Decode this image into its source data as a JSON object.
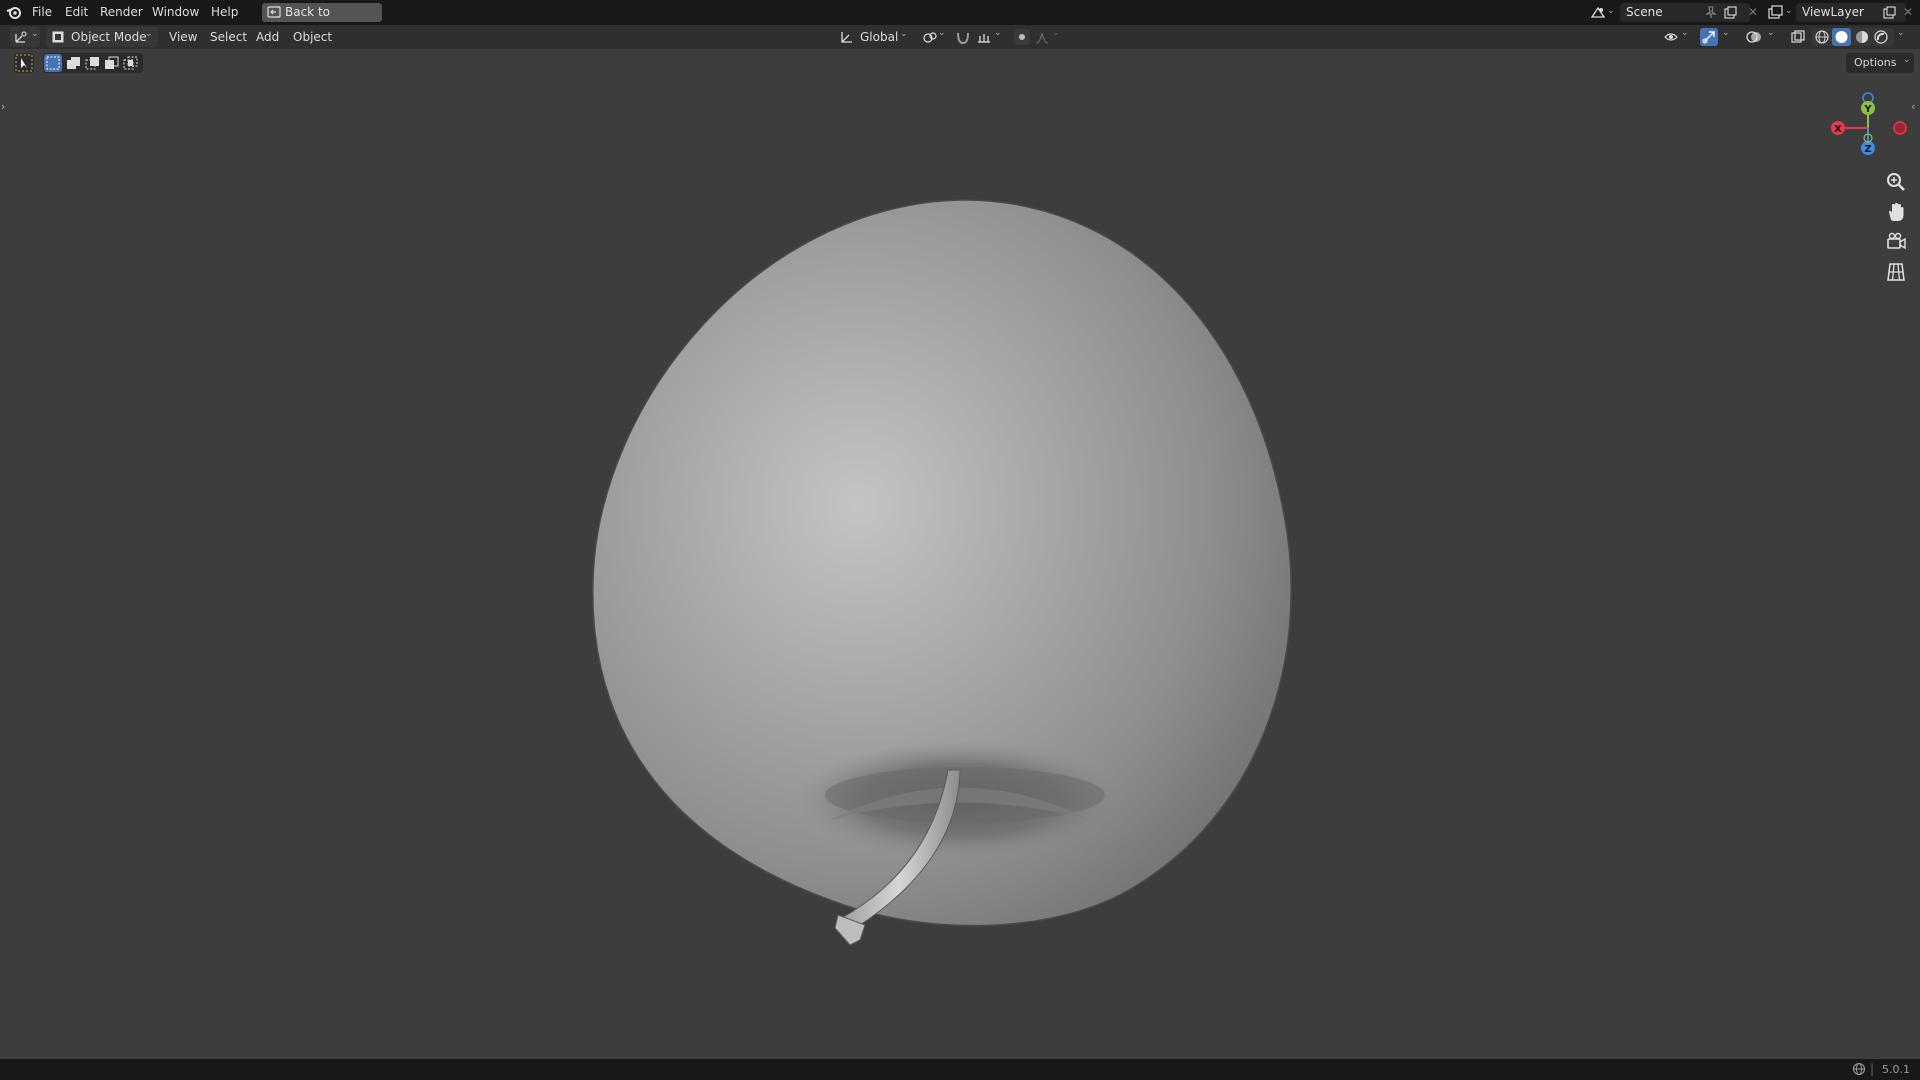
{
  "topbar": {
    "menu": [
      "File",
      "Edit",
      "Render",
      "Window",
      "Help"
    ],
    "back_button": "Back to Previous",
    "scene_name": "Scene",
    "view_layer": "ViewLayer"
  },
  "header": {
    "mode": "Object Mode",
    "menus": [
      "View",
      "Select",
      "Add",
      "Object"
    ],
    "transform_orientation": "Global",
    "options": "Options"
  },
  "gizmo": {
    "x_label": "X",
    "y_label": "Y",
    "z_label": "Z",
    "colors": {
      "x": "#e8394f",
      "y": "#8bc43c",
      "z": "#3b8ce8"
    }
  },
  "nav_icons": [
    "zoom-icon",
    "pan-hand-icon",
    "camera-view-icon",
    "grid-ortho-icon"
  ],
  "status": {
    "version": "5.0.1"
  },
  "viewport": {
    "object": "apple-mesh",
    "shading": "solid"
  },
  "colors": {
    "accent": "#4772b3",
    "viewport_bg": "#3d3d3d"
  }
}
